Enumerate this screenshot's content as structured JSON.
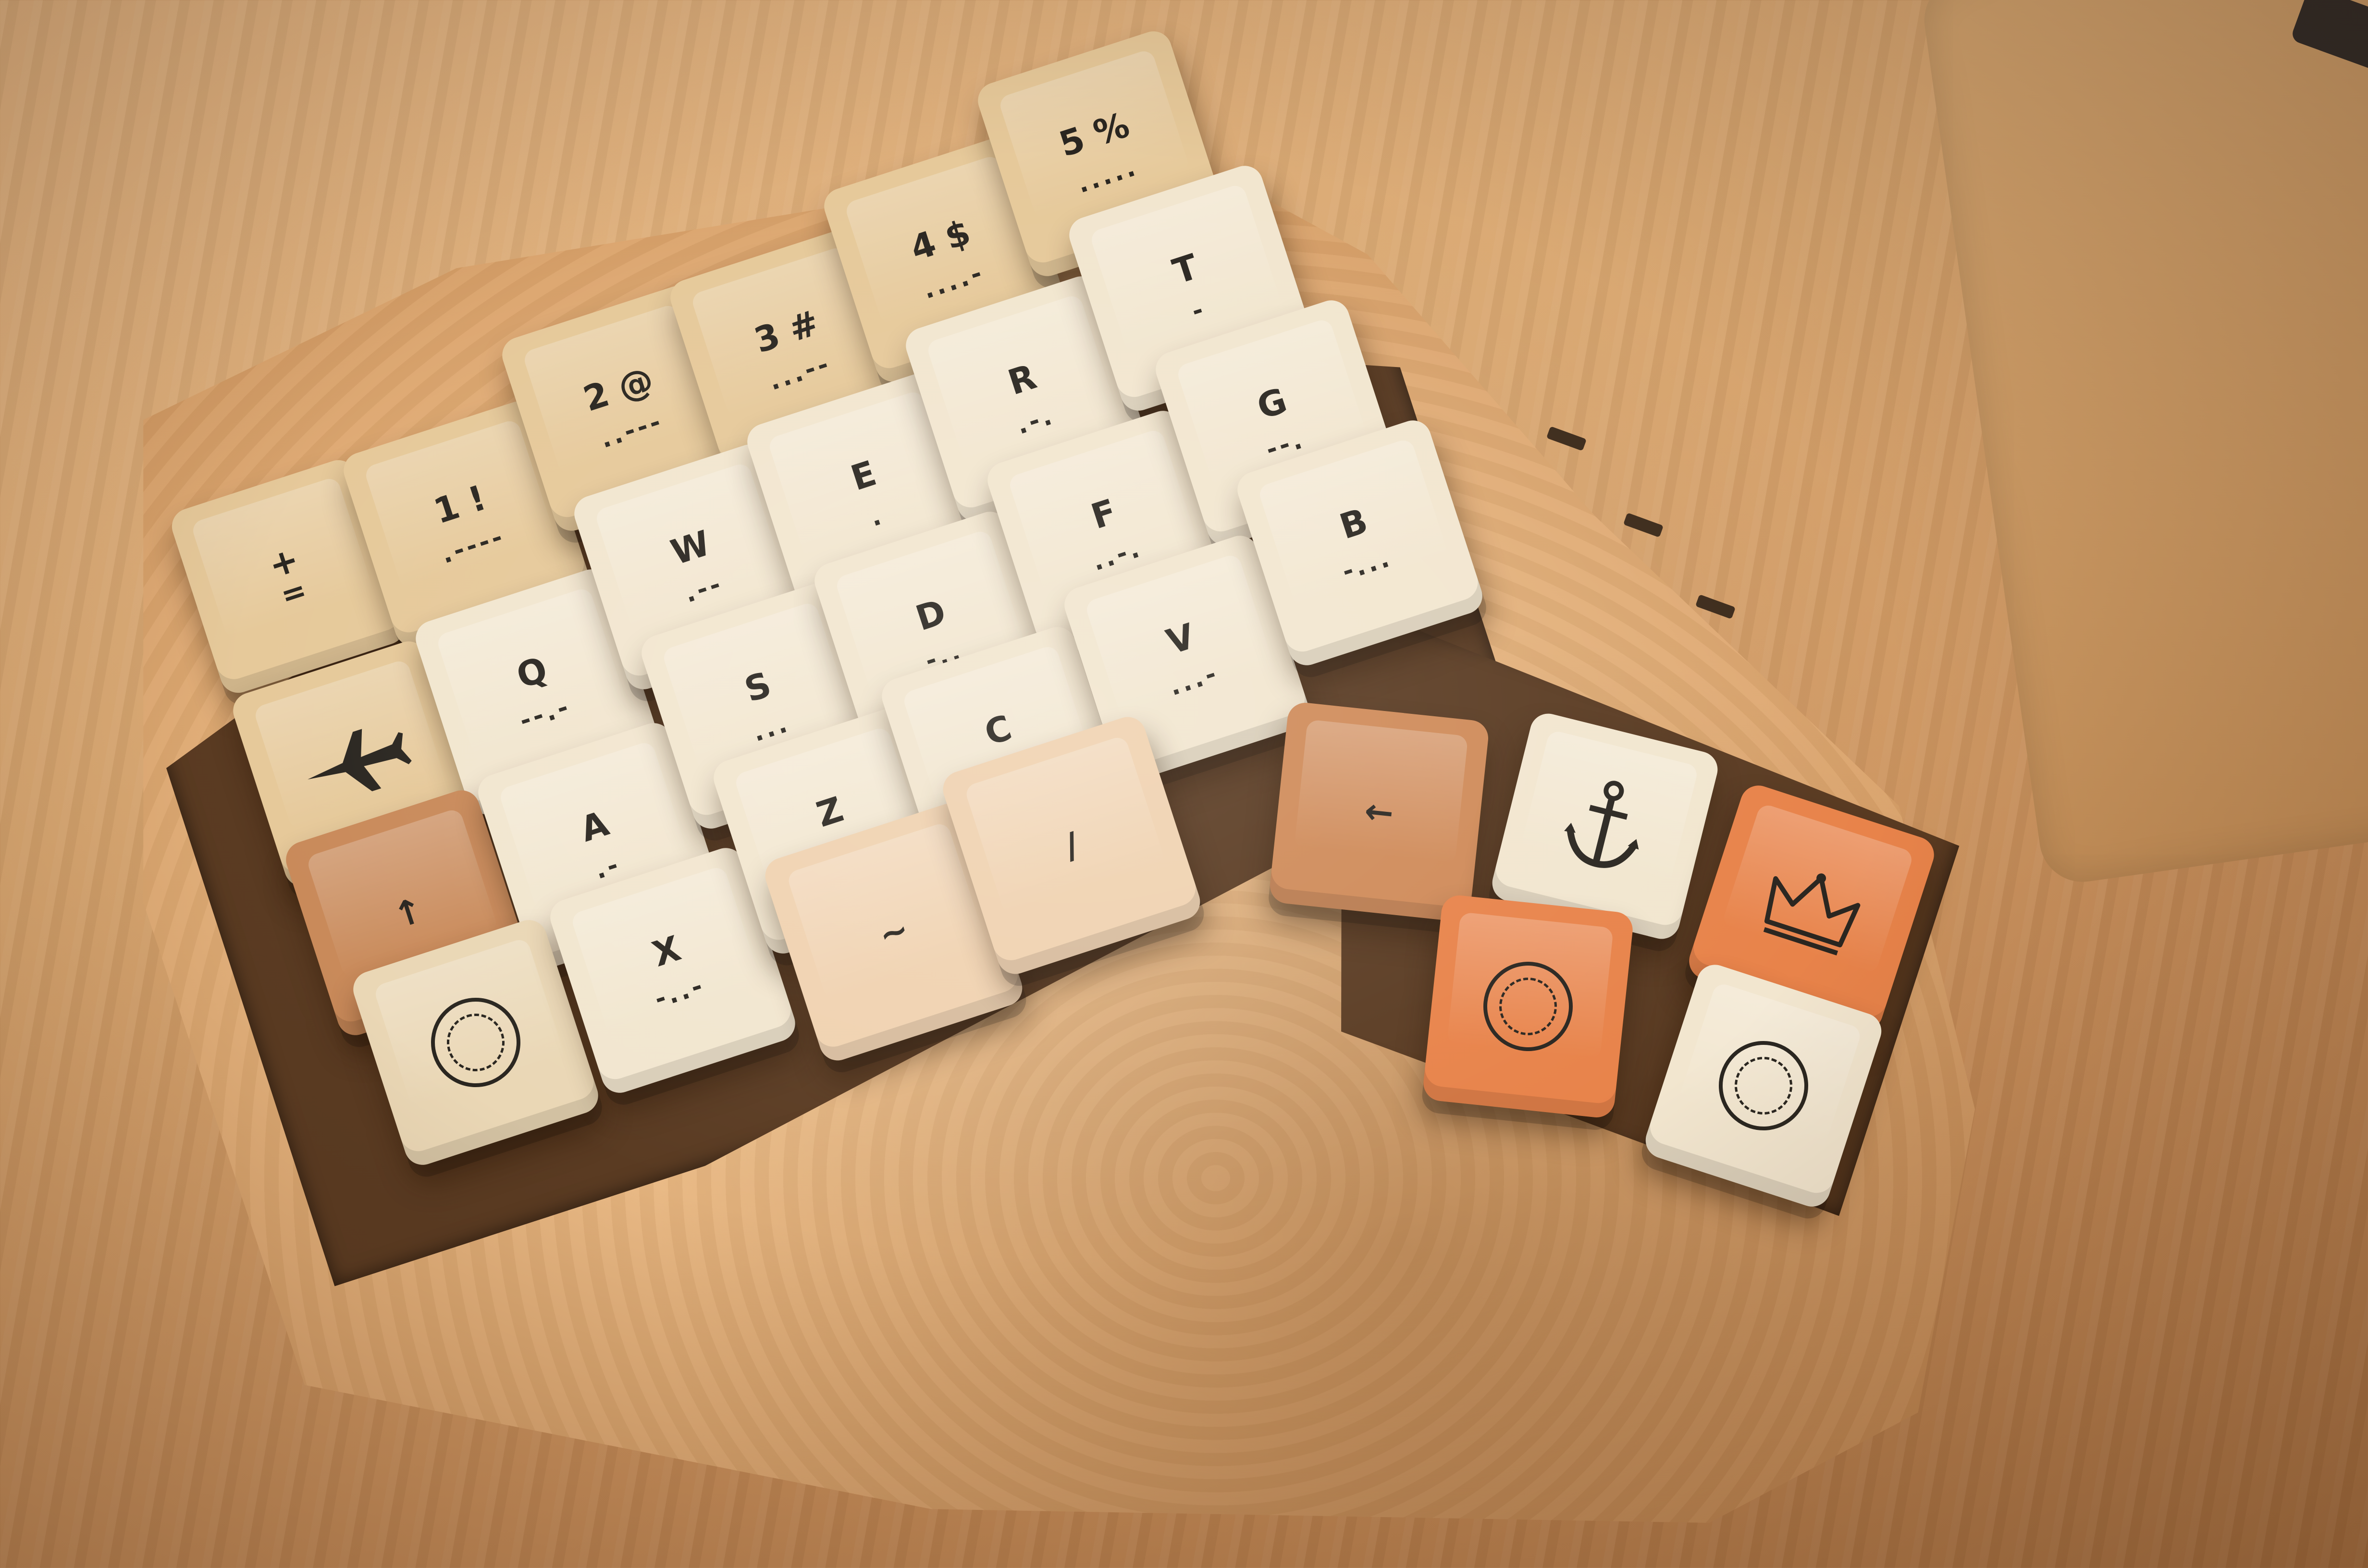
{
  "photo": {
    "keys": [
      {
        "legend": "+",
        "sub": "=",
        "morse": ""
      },
      {
        "legend": "1 !",
        "sub": "",
        "morse": ".----"
      },
      {
        "legend": "2 @",
        "sub": "",
        "morse": "..---"
      },
      {
        "legend": "3 #",
        "sub": "",
        "morse": "...--"
      },
      {
        "legend": "4 $",
        "sub": "",
        "morse": "....-"
      },
      {
        "legend": "5 %",
        "sub": "",
        "morse": "....."
      },
      {
        "legend": "Q",
        "sub": "",
        "morse": "--.-"
      },
      {
        "legend": "W",
        "sub": "",
        "morse": ".--"
      },
      {
        "legend": "E",
        "sub": "",
        "morse": "."
      },
      {
        "legend": "R",
        "sub": "",
        "morse": ".-."
      },
      {
        "legend": "T",
        "sub": "",
        "morse": "-"
      },
      {
        "legend": "A",
        "sub": "",
        "morse": ".-"
      },
      {
        "legend": "S",
        "sub": "",
        "morse": "..."
      },
      {
        "legend": "D",
        "sub": "",
        "morse": "-.."
      },
      {
        "legend": "F",
        "sub": "",
        "morse": "..-."
      },
      {
        "legend": "G",
        "sub": "",
        "morse": "--."
      },
      {
        "legend": "Z",
        "sub": "",
        "morse": "--.."
      },
      {
        "legend": "X",
        "sub": "",
        "morse": "-..-"
      },
      {
        "legend": "C",
        "sub": "",
        "morse": "-.-."
      },
      {
        "legend": "V",
        "sub": "",
        "morse": "...-"
      },
      {
        "legend": "B",
        "sub": "",
        "morse": "-..."
      },
      {
        "legend": "/",
        "sub": "",
        "morse": ""
      },
      {
        "legend": "~",
        "sub": "",
        "morse": ""
      },
      {
        "legend": "↑",
        "sub": "",
        "morse": ""
      },
      {
        "legend": "←",
        "sub": "",
        "morse": ""
      }
    ],
    "icons": [
      "airplane-icon",
      "anchor-icon",
      "crown-icon",
      "seal-stamp-icon"
    ],
    "colors": {
      "wood": "#d9a770",
      "cream": "#f2e6cf",
      "beige": "#e6c99a",
      "orange": "#e8834a",
      "tan": "#c98a5a",
      "legend": "#2a2620"
    }
  }
}
